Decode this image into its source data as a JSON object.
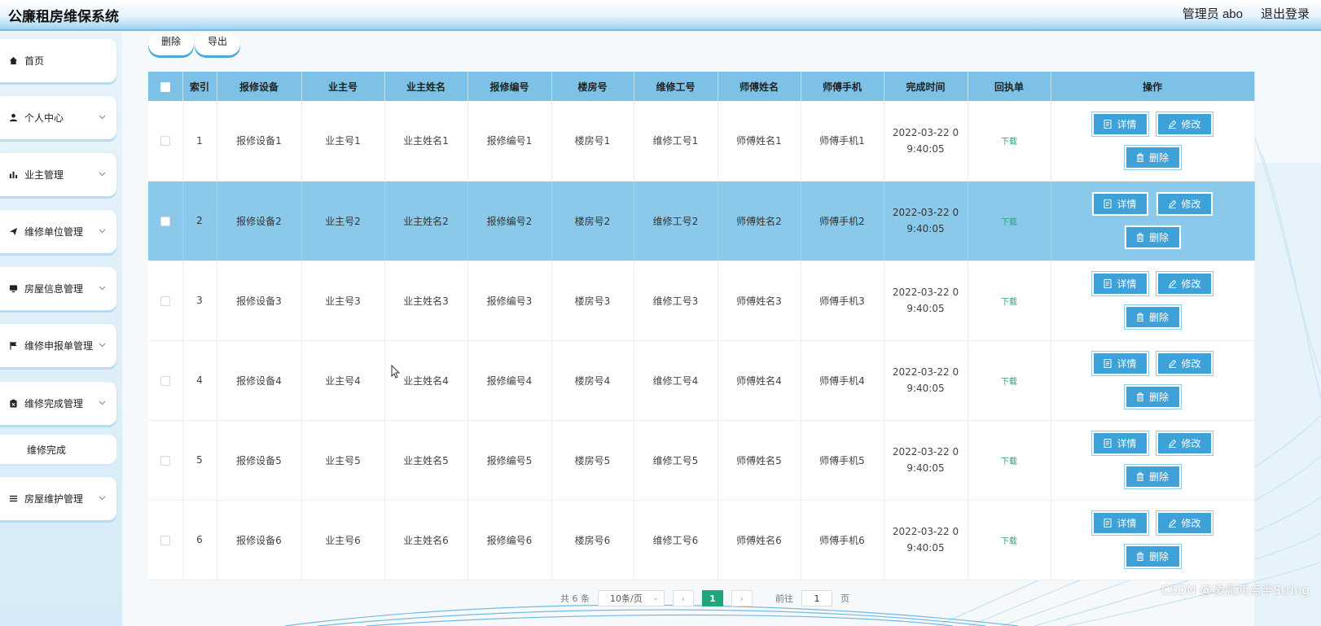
{
  "header": {
    "title": "公廉租房维保系统",
    "user_label": "管理员 abo",
    "logout_label": "退出登录"
  },
  "sidebar": {
    "items": [
      {
        "label": "首页",
        "icon": "home-icon",
        "expandable": false
      },
      {
        "label": "个人中心",
        "icon": "person-icon",
        "expandable": true
      },
      {
        "label": "业主管理",
        "icon": "bar-chart-icon",
        "expandable": true
      },
      {
        "label": "维修单位管理",
        "icon": "send-icon",
        "expandable": true
      },
      {
        "label": "房屋信息管理",
        "icon": "monitor-icon",
        "expandable": true
      },
      {
        "label": "维修申报单管理",
        "icon": "flag-icon",
        "expandable": true
      },
      {
        "label": "维修完成管理",
        "icon": "clipboard-icon",
        "expandable": true
      },
      {
        "label": "房屋维护管理",
        "icon": "menu-icon",
        "expandable": true
      }
    ],
    "submenu": {
      "label": "维修完成"
    }
  },
  "toolbar": {
    "delete_label": "删除",
    "export_label": "导出"
  },
  "table": {
    "columns": [
      "索引",
      "报修设备",
      "业主号",
      "业主姓名",
      "报修编号",
      "楼房号",
      "维修工号",
      "师傅姓名",
      "师傅手机",
      "完成时间",
      "回执单",
      "操作"
    ],
    "rows": [
      {
        "index": "1",
        "device": "报修设备1",
        "owner_no": "业主号1",
        "owner_name": "业主姓名1",
        "repair_no": "报修编号1",
        "building": "楼房号1",
        "worker_no": "维修工号1",
        "master_name": "师傅姓名1",
        "master_phone": "师傅手机1",
        "time_line1": "2022-03-22 0",
        "time_line2": "9:40:05",
        "receipt": "下载"
      },
      {
        "index": "2",
        "device": "报修设备2",
        "owner_no": "业主号2",
        "owner_name": "业主姓名2",
        "repair_no": "报修编号2",
        "building": "楼房号2",
        "worker_no": "维修工号2",
        "master_name": "师傅姓名2",
        "master_phone": "师傅手机2",
        "time_line1": "2022-03-22 0",
        "time_line2": "9:40:05",
        "receipt": "下载"
      },
      {
        "index": "3",
        "device": "报修设备3",
        "owner_no": "业主号3",
        "owner_name": "业主姓名3",
        "repair_no": "报修编号3",
        "building": "楼房号3",
        "worker_no": "维修工号3",
        "master_name": "师傅姓名3",
        "master_phone": "师傅手机3",
        "time_line1": "2022-03-22 0",
        "time_line2": "9:40:05",
        "receipt": "下载"
      },
      {
        "index": "4",
        "device": "报修设备4",
        "owner_no": "业主号4",
        "owner_name": "业主姓名4",
        "repair_no": "报修编号4",
        "building": "楼房号4",
        "worker_no": "维修工号4",
        "master_name": "师傅姓名4",
        "master_phone": "师傅手机4",
        "time_line1": "2022-03-22 0",
        "time_line2": "9:40:05",
        "receipt": "下载"
      },
      {
        "index": "5",
        "device": "报修设备5",
        "owner_no": "业主号5",
        "owner_name": "业主姓名5",
        "repair_no": "报修编号5",
        "building": "楼房号5",
        "worker_no": "维修工号5",
        "master_name": "师傅姓名5",
        "master_phone": "师傅手机5",
        "time_line1": "2022-03-22 0",
        "time_line2": "9:40:05",
        "receipt": "下载"
      },
      {
        "index": "6",
        "device": "报修设备6",
        "owner_no": "业主号6",
        "owner_name": "业主姓名6",
        "repair_no": "报修编号6",
        "building": "楼房号6",
        "worker_no": "维修工号6",
        "master_name": "师傅姓名6",
        "master_phone": "师傅手机6",
        "time_line1": "2022-03-22 0",
        "time_line2": "9:40:05",
        "receipt": "下载"
      }
    ],
    "highlighted_row": "2",
    "actions": {
      "detail": "详情",
      "edit": "修改",
      "delete": "删除"
    }
  },
  "pagination": {
    "total_text": "共 6 条",
    "page_size": "10条/页",
    "current_page": "1",
    "goto_label": "前往",
    "goto_value": "1",
    "page_suffix": "页"
  },
  "watermark": "CSDN @凌晨两点半String",
  "colors": {
    "accent": "#3ea2d8",
    "header_row": "#7dc2e6",
    "highlight_row": "#8bc9ea",
    "download_link": "#2aa37a",
    "page_active": "#20a67c"
  }
}
